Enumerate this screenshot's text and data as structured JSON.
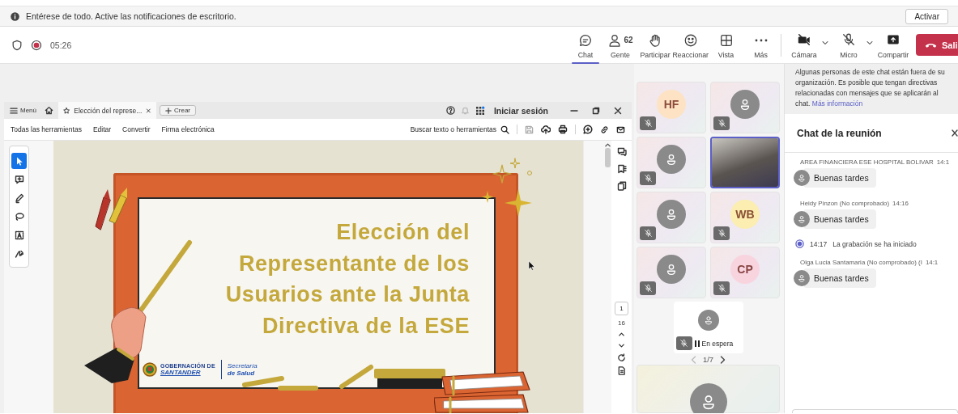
{
  "notification": {
    "message": "Entérese de todo. Active las notificaciones de escritorio.",
    "button": "Activar"
  },
  "meeting_bar": {
    "recording": true,
    "elapsed": "05:26",
    "tools": [
      {
        "kind": "chat",
        "label": "Chat",
        "selected": true
      },
      {
        "kind": "people",
        "label": "Gente",
        "count": "62",
        "selected": false
      },
      {
        "kind": "raise_hand",
        "label": "Participar",
        "selected": false
      },
      {
        "kind": "react",
        "label": "Reaccionar",
        "selected": false
      },
      {
        "kind": "view",
        "label": "Vista",
        "selected": false
      },
      {
        "kind": "more",
        "label": "Más",
        "selected": false
      }
    ],
    "devices": [
      {
        "kind": "camera",
        "label": "Cámara",
        "off": true,
        "dropdown": true
      },
      {
        "kind": "mic",
        "label": "Micro",
        "off": true,
        "dropdown": true
      },
      {
        "kind": "share",
        "label": "Compartir",
        "off": false,
        "dropdown": false
      }
    ],
    "leave_button": "Sali"
  },
  "pdf_viewer": {
    "menu_label": "Menú",
    "tab_title": "Elección del represe...",
    "new_button": "Crear",
    "sign_in": "Iniciar sesión",
    "menu_items": [
      "Todas las herramientas",
      "Editar",
      "Convertir",
      "Firma electrónica"
    ],
    "search_label": "Buscar texto o herramientas",
    "tools": [
      {
        "kind": "select",
        "selected": true
      },
      {
        "kind": "comment",
        "selected": false
      },
      {
        "kind": "draw",
        "selected": false
      },
      {
        "kind": "lasso",
        "selected": false
      },
      {
        "kind": "text",
        "selected": false
      },
      {
        "kind": "sign",
        "selected": false
      }
    ],
    "page_current": "1",
    "page_total": "16"
  },
  "slide": {
    "title_lines": [
      "Elección del",
      "Representante de los",
      "Usuarios ante la Junta",
      "Directiva de la ESE"
    ],
    "logo": {
      "org_line1": "GOBERNACIÓN DE",
      "org_line2": "SANTANDER",
      "dept_line1": "Secretaría",
      "dept_line2": "de Salud"
    }
  },
  "gallery": {
    "tiles": [
      {
        "kind": "initials",
        "initials": "HF",
        "color": "#fde3c4",
        "muted": true,
        "speaking": false
      },
      {
        "kind": "default",
        "muted": true,
        "speaking": false
      },
      {
        "kind": "default",
        "muted": true,
        "speaking": false
      },
      {
        "kind": "video",
        "muted": false,
        "speaking": true
      },
      {
        "kind": "default",
        "muted": true,
        "speaking": false
      },
      {
        "kind": "initials",
        "initials": "WB",
        "color": "#fbeeb0",
        "muted": true,
        "speaking": false
      },
      {
        "kind": "default",
        "muted": true,
        "speaking": false
      },
      {
        "kind": "initials",
        "initials": "CP",
        "color": "#f8d4df",
        "muted": true,
        "speaking": false
      }
    ],
    "waiting": {
      "label": "En espera",
      "muted": true
    },
    "pager": "1/7",
    "more_tiles": [
      {
        "kind": "default"
      }
    ]
  },
  "chat_panel": {
    "banner": "Algunas personas de este chat están fuera de su organización. Es posible que tengan directivas relacionadas con mensajes que se aplicarán al chat.",
    "banner_link": "Más información",
    "title": "Chat de la reunión",
    "messages": [
      {
        "kind": "message",
        "sender": "AREA FINANCIERA ESE HOSPITAL BOLIVAR",
        "time": "14:1",
        "text": "Buenas tardes"
      },
      {
        "kind": "message",
        "sender": "Heidy Pinzon (No comprobado)",
        "time": "14:16",
        "text": "Buenas tardes"
      },
      {
        "kind": "system",
        "time": "14:17",
        "text": "La grabación se ha iniciado"
      },
      {
        "kind": "message",
        "sender": "Olga Lucia Santamaria (No comprobado) (I",
        "time": "14:1",
        "text": "Buenas tardes"
      }
    ]
  }
}
